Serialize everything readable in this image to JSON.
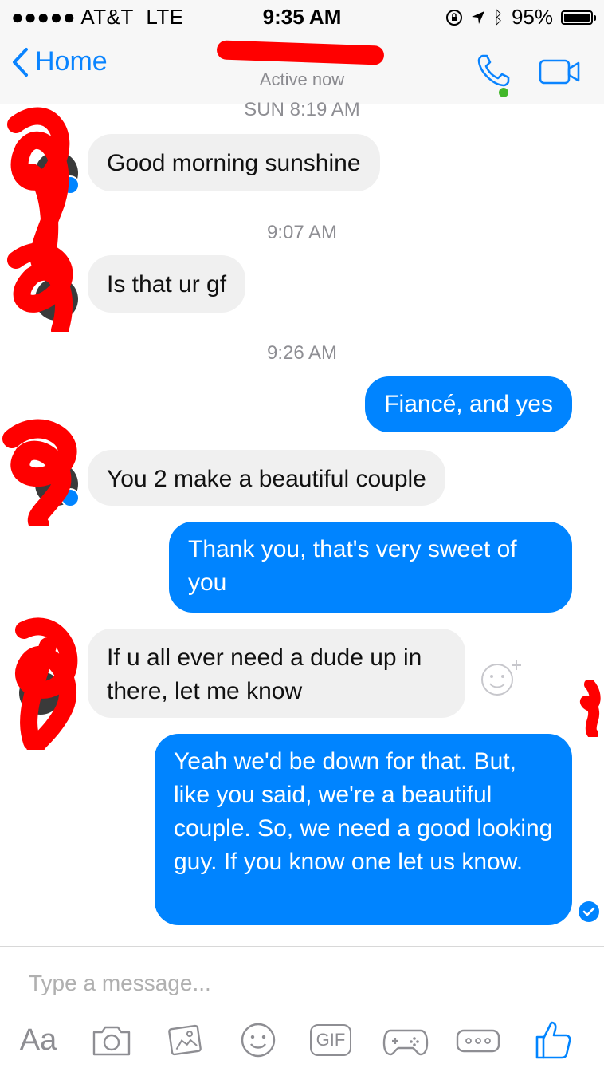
{
  "status_bar": {
    "signal_dots": "●●●●●",
    "carrier": "AT&T",
    "network": "LTE",
    "time": "9:35 AM",
    "battery": "95%"
  },
  "nav": {
    "back_label": "Home",
    "status": "Active now"
  },
  "conversation": {
    "timestamps": [
      "SUN 8:19 AM",
      "9:07 AM",
      "9:26 AM"
    ],
    "messages": [
      {
        "side": "in",
        "text": "Good morning sunshine"
      },
      {
        "side": "in",
        "text": "Is that ur gf"
      },
      {
        "side": "out",
        "text": "Fiancé, and yes"
      },
      {
        "side": "in",
        "text": "You 2 make a beautiful couple"
      },
      {
        "side": "out",
        "text": "Thank you, that's very sweet of you"
      },
      {
        "side": "in",
        "text": "If u all ever need a dude up in there, let me know"
      },
      {
        "side": "out",
        "text": "Yeah we'd be down for that. But, like you said, we're a beautiful couple. So, we need a good looking guy. If you know one let us know."
      }
    ]
  },
  "composer": {
    "placeholder": "Type a message...",
    "tools": [
      "Aa",
      "camera-icon",
      "photo-icon",
      "emoji-icon",
      "GIF",
      "game-icon",
      "more-icon",
      "like-icon"
    ]
  },
  "colors": {
    "accent": "#0084ff",
    "ios_blue": "#0a84ff",
    "incoming_bubble": "#f0f0f0",
    "active_dot": "#42b72a",
    "redaction": "#ff0000"
  }
}
